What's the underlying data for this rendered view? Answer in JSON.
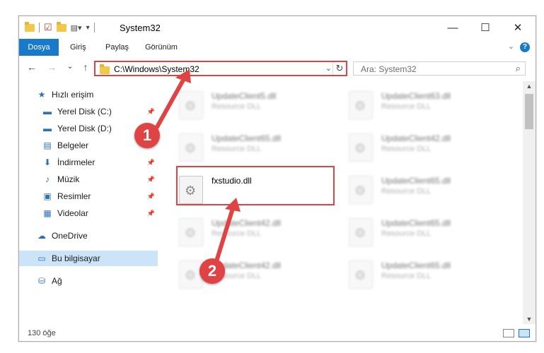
{
  "window": {
    "title": "System32",
    "controls": {
      "minimize": "—",
      "maximize": "☐",
      "close": "✕"
    }
  },
  "ribbon": {
    "tabs": [
      "Dosya",
      "Giriş",
      "Paylaş",
      "Görünüm"
    ],
    "help": "?"
  },
  "nav": {
    "back": "←",
    "forward": "→",
    "recent": "⌄",
    "up": "↑",
    "address": "C:\\Windows\\System32",
    "search_placeholder": "Ara: System32"
  },
  "sidebar": {
    "items": [
      {
        "label": "Hızlı erişim",
        "icon": "star-icon",
        "glyph": "★",
        "pinned": false
      },
      {
        "label": "Yerel Disk (C:)",
        "icon": "drive-icon",
        "glyph": "▬",
        "pinned": true
      },
      {
        "label": "Yerel Disk (D:)",
        "icon": "drive-icon",
        "glyph": "▬",
        "pinned": true
      },
      {
        "label": "Belgeler",
        "icon": "document-icon",
        "glyph": "▤",
        "pinned": true
      },
      {
        "label": "İndirmeler",
        "icon": "download-icon",
        "glyph": "⬇",
        "pinned": true
      },
      {
        "label": "Müzik",
        "icon": "music-icon",
        "glyph": "♪",
        "pinned": true
      },
      {
        "label": "Resimler",
        "icon": "pictures-icon",
        "glyph": "▣",
        "pinned": true
      },
      {
        "label": "Videolar",
        "icon": "video-icon",
        "glyph": "▦",
        "pinned": true
      },
      {
        "label": "OneDrive",
        "icon": "cloud-icon",
        "glyph": "☁",
        "pinned": false
      },
      {
        "label": "Bu bilgisayar",
        "icon": "computer-icon",
        "glyph": "▭",
        "pinned": false,
        "selected": true
      },
      {
        "label": "Ağ",
        "icon": "network-icon",
        "glyph": "⛁",
        "pinned": false
      }
    ]
  },
  "files": {
    "left_column": [
      {
        "name": "UpdateClient5.dll",
        "type": "Resource DLL",
        "blurred": true
      },
      {
        "name": "UpdateClient65.dll",
        "type": "Resource DLL",
        "blurred": true
      },
      {
        "name": "fxstudio.dll",
        "type": "",
        "blurred": false
      },
      {
        "name": "UpdateClient42.dll",
        "type": "Resource DLL",
        "blurred": true
      },
      {
        "name": "UpdateClient42.dll",
        "type": "Resource DLL",
        "blurred": true
      }
    ],
    "right_column": [
      {
        "name": "UpdateClient63.dll",
        "type": "Resource DLL",
        "blurred": true
      },
      {
        "name": "UpdateClient42.dll",
        "type": "Resource DLL",
        "blurred": true
      },
      {
        "name": "UpdateClient65.dll",
        "type": "Resource DLL",
        "blurred": true
      },
      {
        "name": "UpdateClient65.dll",
        "type": "Resource DLL",
        "blurred": true
      },
      {
        "name": "UpdateClient65.dll",
        "type": "Resource DLL",
        "blurred": true
      }
    ]
  },
  "annotations": {
    "callout_1": "1",
    "callout_2": "2"
  },
  "status": {
    "count": "130 öğe"
  },
  "colors": {
    "accent": "#1979ca",
    "highlight": "#e04343",
    "selected_bg": "#cce4f7"
  }
}
